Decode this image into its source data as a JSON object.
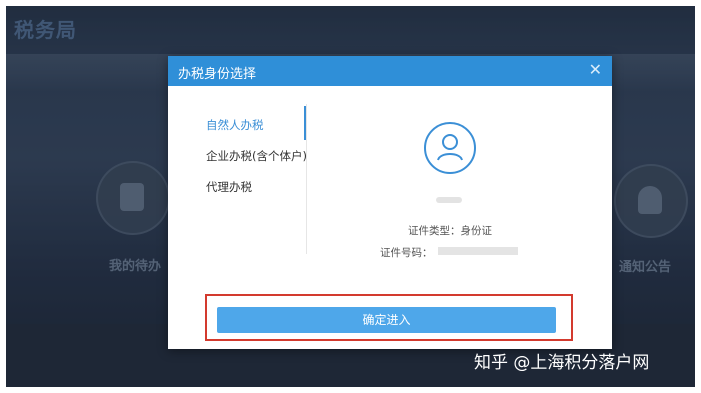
{
  "site": {
    "title": "税务局"
  },
  "background": {
    "left_shortcut_label": "我的待办",
    "right_shortcut_label": "通知公告",
    "left_icon": "document-icon",
    "right_icon": "bell-icon"
  },
  "modal": {
    "title": "办税身份选择",
    "close_icon": "close-icon",
    "tabs": [
      {
        "label": "自然人办税",
        "active": true
      },
      {
        "label": "企业办税(含个体户)",
        "active": false
      },
      {
        "label": "代理办税",
        "active": false
      }
    ],
    "avatar_icon": "user-icon",
    "id_type_label": "证件类型：",
    "id_type_value": "身份证",
    "id_number_label": "证件号码：",
    "confirm_label": "确定进入"
  },
  "watermark": "知乎 @上海积分落户网",
  "colors": {
    "header": "#2f8fd8",
    "button": "#4ea7ea",
    "active_tab": "#3b8fd6",
    "highlight_border": "#d33a2e"
  }
}
